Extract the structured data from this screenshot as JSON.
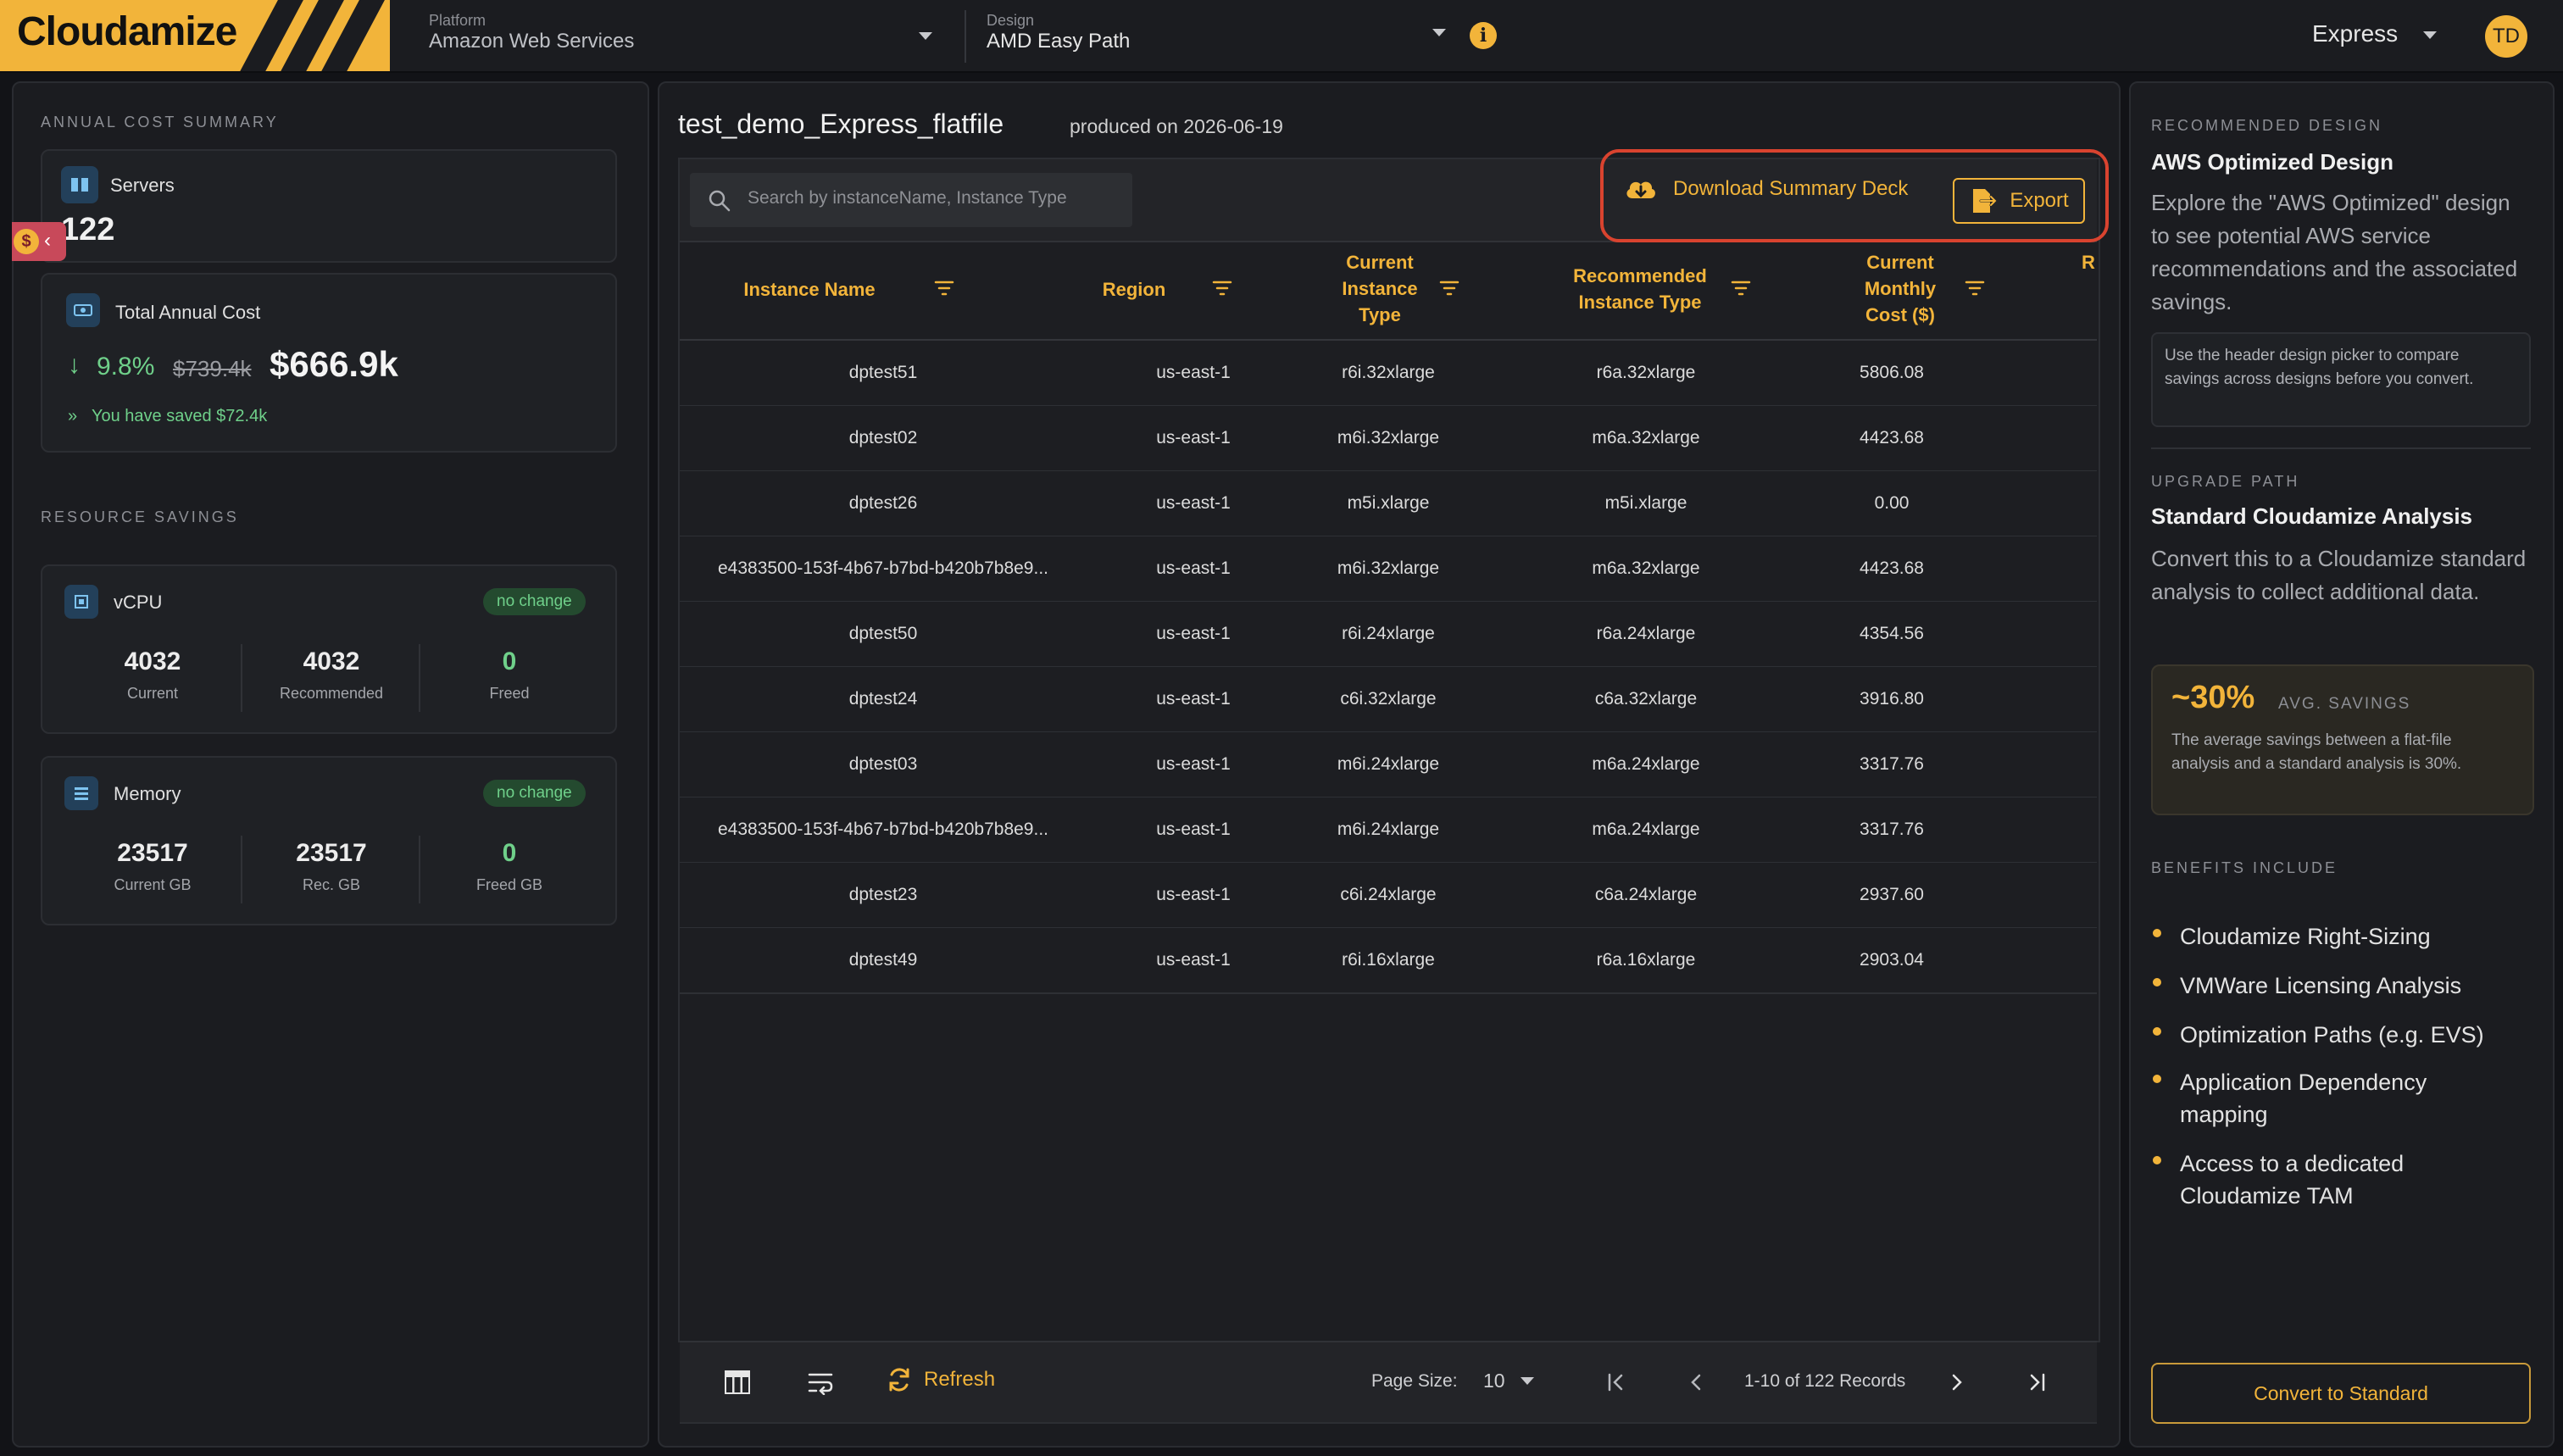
{
  "header": {
    "logo": "Cloudamize",
    "platform_label": "Platform",
    "platform_value": "Amazon Web Services",
    "design_label": "Design",
    "design_value": "AMD Easy Path",
    "plan": "Express",
    "avatar_initials": "TD",
    "info_glyph": "i"
  },
  "left": {
    "annual_section_label": "ANNUAL COST SUMMARY",
    "servers_label": "Servers",
    "servers_value": "122",
    "total_cost_label": "Total Annual Cost",
    "pct_change": "9.8%",
    "old_cost": "$739.4k",
    "new_cost": "$666.9k",
    "saved_text": "You have saved $72.4k",
    "resource_section_label": "RESOURCE SAVINGS",
    "vcpu": {
      "title": "vCPU",
      "badge": "no change",
      "stats": [
        {
          "value": "4032",
          "label": "Current"
        },
        {
          "value": "4032",
          "label": "Recommended"
        },
        {
          "value": "0",
          "label": "Freed"
        }
      ]
    },
    "memory": {
      "title": "Memory",
      "badge": "no change",
      "stats": [
        {
          "value": "23517",
          "label": "Current GB"
        },
        {
          "value": "23517",
          "label": "Rec. GB"
        },
        {
          "value": "0",
          "label": "Freed GB"
        }
      ]
    }
  },
  "main": {
    "title": "test_demo_Express_flatfile",
    "subtitle": "produced on 2026-06-19",
    "search_placeholder": "Search by instanceName, Instance Type",
    "download_label": "Download Summary Deck",
    "export_label": "Export",
    "columns": [
      "Instance Name",
      "Region",
      "Current\nInstance\nType",
      "Recommended\nInstance Type",
      "Current\nMonthly\nCost ($)",
      "R"
    ],
    "rows": [
      [
        "dptest51",
        "us-east-1",
        "r6i.32xlarge",
        "r6a.32xlarge",
        "5806.08"
      ],
      [
        "dptest02",
        "us-east-1",
        "m6i.32xlarge",
        "m6a.32xlarge",
        "4423.68"
      ],
      [
        "dptest26",
        "us-east-1",
        "m5i.xlarge",
        "m5i.xlarge",
        "0.00"
      ],
      [
        "e4383500-153f-4b67-b7bd-b420b7b8e9...",
        "us-east-1",
        "m6i.32xlarge",
        "m6a.32xlarge",
        "4423.68"
      ],
      [
        "dptest50",
        "us-east-1",
        "r6i.24xlarge",
        "r6a.24xlarge",
        "4354.56"
      ],
      [
        "dptest24",
        "us-east-1",
        "c6i.32xlarge",
        "c6a.32xlarge",
        "3916.80"
      ],
      [
        "dptest03",
        "us-east-1",
        "m6i.24xlarge",
        "m6a.24xlarge",
        "3317.76"
      ],
      [
        "e4383500-153f-4b67-b7bd-b420b7b8e9...",
        "us-east-1",
        "m6i.24xlarge",
        "m6a.24xlarge",
        "3317.76"
      ],
      [
        "dptest23",
        "us-east-1",
        "c6i.24xlarge",
        "c6a.24xlarge",
        "2937.60"
      ],
      [
        "dptest49",
        "us-east-1",
        "r6i.16xlarge",
        "r6a.16xlarge",
        "2903.04"
      ]
    ],
    "footer": {
      "refresh_label": "Refresh",
      "page_size_label": "Page Size:",
      "page_size_value": "10",
      "records_text": "1-10 of 122 Records"
    }
  },
  "right": {
    "rec_label": "RECOMMENDED DESIGN",
    "rec_title": "AWS Optimized Design",
    "rec_body": "Explore the \"AWS Optimized\" design to see potential AWS service recommendations and the associated savings.",
    "rec_note": "Use the header design picker to compare savings across designs before you convert.",
    "upgrade_label": "UPGRADE PATH",
    "upgrade_title": "Standard Cloudamize Analysis",
    "upgrade_body": "Convert this to a Cloudamize standard analysis to collect additional data.",
    "savings_pct": "~30%",
    "savings_label": "AVG. SAVINGS",
    "savings_body": "The average savings between a flat-file analysis and a standard analysis is 30%.",
    "benefits_label": "BENEFITS INCLUDE",
    "benefits": [
      "Cloudamize Right-Sizing",
      "VMWare Licensing Analysis",
      "Optimization Paths (e.g. EVS)",
      "Application Dependency mapping",
      "Access to a dedicated Cloudamize TAM"
    ],
    "convert_label": "Convert to Standard"
  },
  "colors": {
    "accent": "#f2b43a",
    "background": "#121317",
    "panel": "#1b1c20",
    "positive": "#6fd08a",
    "highlight_outline": "#d9432f"
  }
}
